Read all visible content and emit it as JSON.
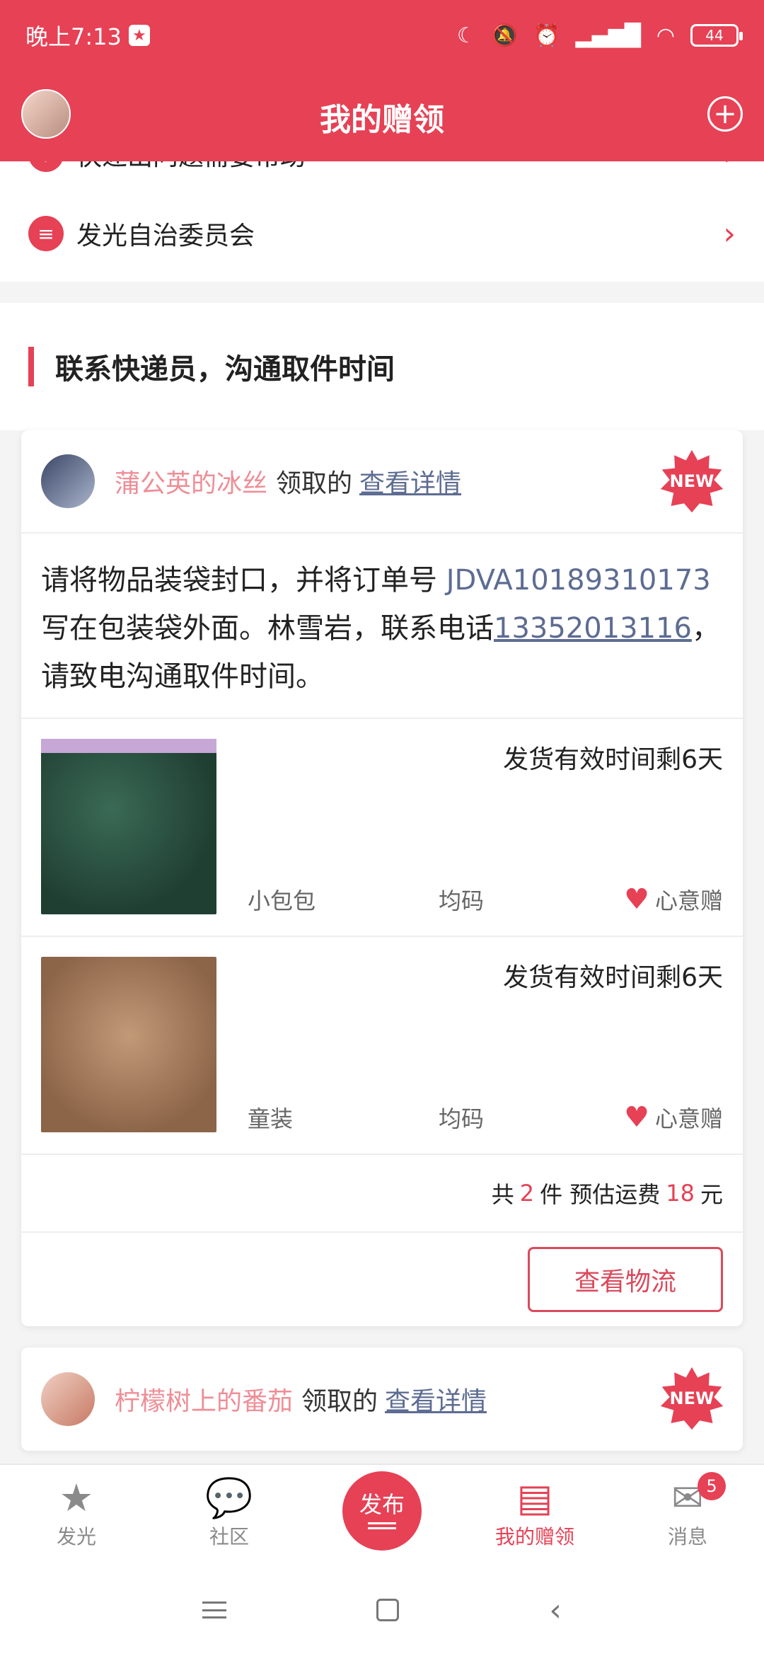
{
  "status": {
    "time": "晚上7:13",
    "battery": "44"
  },
  "header": {
    "title": "我的赠领",
    "plus": "+"
  },
  "menu": {
    "item1": "快递出问题需要帮助",
    "item2": "发光自治委员会"
  },
  "section": {
    "title": "联系快递员，沟通取件时间"
  },
  "card1": {
    "name": "蒲公英的冰丝",
    "verb": "领取的",
    "link": "查看详情",
    "badge": "NEW",
    "message_pre": "请将物品装袋封口，并将订单号 ",
    "order": "JDVA10189310173",
    "message_mid": " 写在包装袋外面。林雪岩，联系电话",
    "phone": "13352013116",
    "message_post": "，请致电沟通取件时间。",
    "items": [
      {
        "deadline": "发货有效时间剩6天",
        "category": "小包包",
        "size": "均码",
        "tag": "心意赠"
      },
      {
        "deadline": "发货有效时间剩6天",
        "category": "童装",
        "size": "均码",
        "tag": "心意赠"
      }
    ],
    "summary": {
      "pre": "共",
      "count": "2",
      "mid": "件 预估运费",
      "fee": "18",
      "post": "元"
    },
    "action": "查看物流"
  },
  "card2": {
    "name": "柠檬树上的番茄",
    "verb": "领取的",
    "link": "查看详情",
    "badge": "NEW"
  },
  "nav": {
    "items": [
      {
        "label": "发光"
      },
      {
        "label": "社区"
      },
      {
        "label": "发布"
      },
      {
        "label": "我的赠领"
      },
      {
        "label": "消息"
      }
    ],
    "message_badge": "5"
  }
}
